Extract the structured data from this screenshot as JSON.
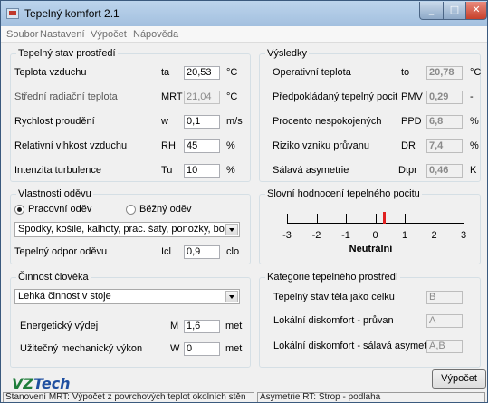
{
  "window": {
    "title": "Tepelný komfort 2.1"
  },
  "menu": [
    "Soubor",
    "Nastavení",
    "Výpočet",
    "Nápověda"
  ],
  "environment": {
    "title": "Tepelný stav prostředí",
    "rows": [
      {
        "label": "Teplota vzduchu",
        "symbol": "ta",
        "value": "20,53",
        "unit": "°C"
      },
      {
        "label": "Střední radiační teplota",
        "symbol": "MRT",
        "value": "21,04",
        "unit": "°C"
      },
      {
        "label": "Rychlost proudění",
        "symbol": "w",
        "value": "0,1",
        "unit": "m/s"
      },
      {
        "label": "Relativní vlhkost vzduchu",
        "symbol": "RH",
        "value": "45",
        "unit": "%"
      },
      {
        "label": "Intenzita turbulence",
        "symbol": "Tu",
        "value": "10",
        "unit": "%"
      }
    ]
  },
  "clothing": {
    "title": "Vlastnosti oděvu",
    "radio_work": "Pracovní oděv",
    "radio_casual": "Běžný oděv",
    "selected": "work",
    "combo_value": "Spodky, košile, kalhoty, prac. šaty, ponožky, boty",
    "resistance_label": "Tepelný odpor oděvu",
    "resistance_symbol": "Icl",
    "resistance_value": "0,9",
    "resistance_unit": "clo"
  },
  "activity": {
    "title": "Činnost člověka",
    "combo_value": "Lehká činnost v stoje",
    "energy_label": "Energetický výdej",
    "energy_symbol": "M",
    "energy_value": "1,6",
    "energy_unit": "met",
    "work_label": "Užitečný mechanický výkon",
    "work_symbol": "W",
    "work_value": "0",
    "work_unit": "met"
  },
  "results": {
    "title": "Výsledky",
    "rows": [
      {
        "label": "Operativní teplota",
        "symbol": "to",
        "value": "20,78",
        "unit": "°C"
      },
      {
        "label": "Předpokládaný tepelný pocit",
        "symbol": "PMV",
        "value": "0,29",
        "unit": "-"
      },
      {
        "label": "Procento nespokojených",
        "symbol": "PPD",
        "value": "6,8",
        "unit": "%"
      },
      {
        "label": "Riziko vzniku průvanu",
        "symbol": "DR",
        "value": "7,4",
        "unit": "%"
      },
      {
        "label": "Sálavá asymetrie",
        "symbol": "Dtpr",
        "value": "0,46",
        "unit": "K"
      }
    ]
  },
  "rating": {
    "title": "Slovní hodnocení tepelného pocitu",
    "ticks": [
      "-3",
      "-2",
      "-1",
      "0",
      "1",
      "2",
      "3"
    ],
    "pmv_value": 0.29,
    "marker_color": "#e02020",
    "verdict": "Neutrální"
  },
  "category": {
    "title": "Kategorie tepelného prostředí",
    "rows": [
      {
        "label": "Tepelný stav těla jako celku",
        "value": "B"
      },
      {
        "label": "Lokální diskomfort - průvan",
        "value": "A"
      },
      {
        "label": "Lokální diskomfort - sálavá asymetrie",
        "value": "A,B"
      }
    ]
  },
  "compute_button": "Výpočet",
  "logo": {
    "part1": "VZ",
    "part2": "Tech",
    "color1": "#1f7d3a",
    "color2": "#1f4fa0"
  },
  "status": {
    "left": "Stanovení MRT: Výpočet z povrchových teplot okolních stěn",
    "right": "Asymetrie RT: Strop - podlaha"
  }
}
